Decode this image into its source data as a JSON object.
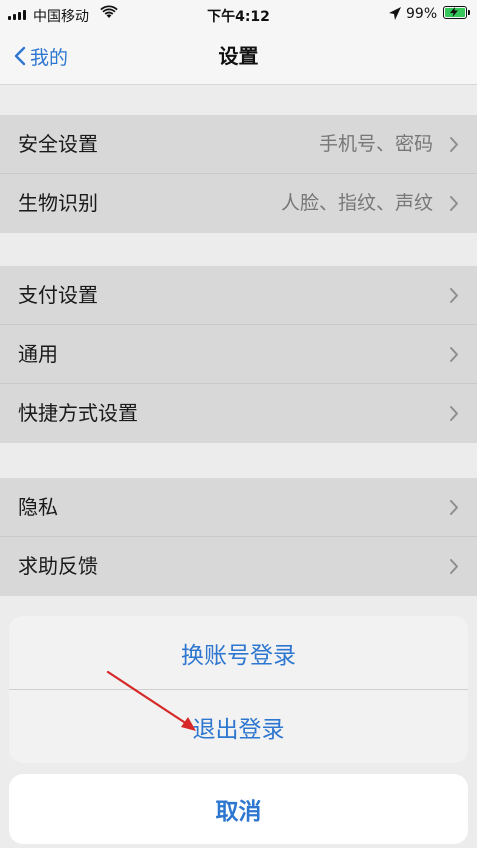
{
  "status_bar": {
    "carrier": "中国移动",
    "time": "下午4:12",
    "battery_pct": "99%",
    "icons": [
      "signal-icon",
      "wifi-icon",
      "location-icon",
      "battery-icon",
      "charging-bolt-icon"
    ]
  },
  "nav": {
    "back_label": "我的",
    "title": "设置"
  },
  "groups": [
    {
      "rows": [
        {
          "label": "安全设置",
          "value": "手机号、密码"
        },
        {
          "label": "生物识别",
          "value": "人脸、指纹、声纹"
        }
      ]
    },
    {
      "rows": [
        {
          "label": "支付设置",
          "value": ""
        },
        {
          "label": "通用",
          "value": ""
        },
        {
          "label": "快捷方式设置",
          "value": ""
        }
      ]
    },
    {
      "rows": [
        {
          "label": "隐私",
          "value": ""
        },
        {
          "label": "求助反馈",
          "value": ""
        }
      ]
    }
  ],
  "action_sheet": {
    "items": [
      "换账号登录",
      "退出登录"
    ],
    "cancel": "取消"
  },
  "colors": {
    "accent": "#2e77d0",
    "annotation_arrow": "#d62828"
  }
}
